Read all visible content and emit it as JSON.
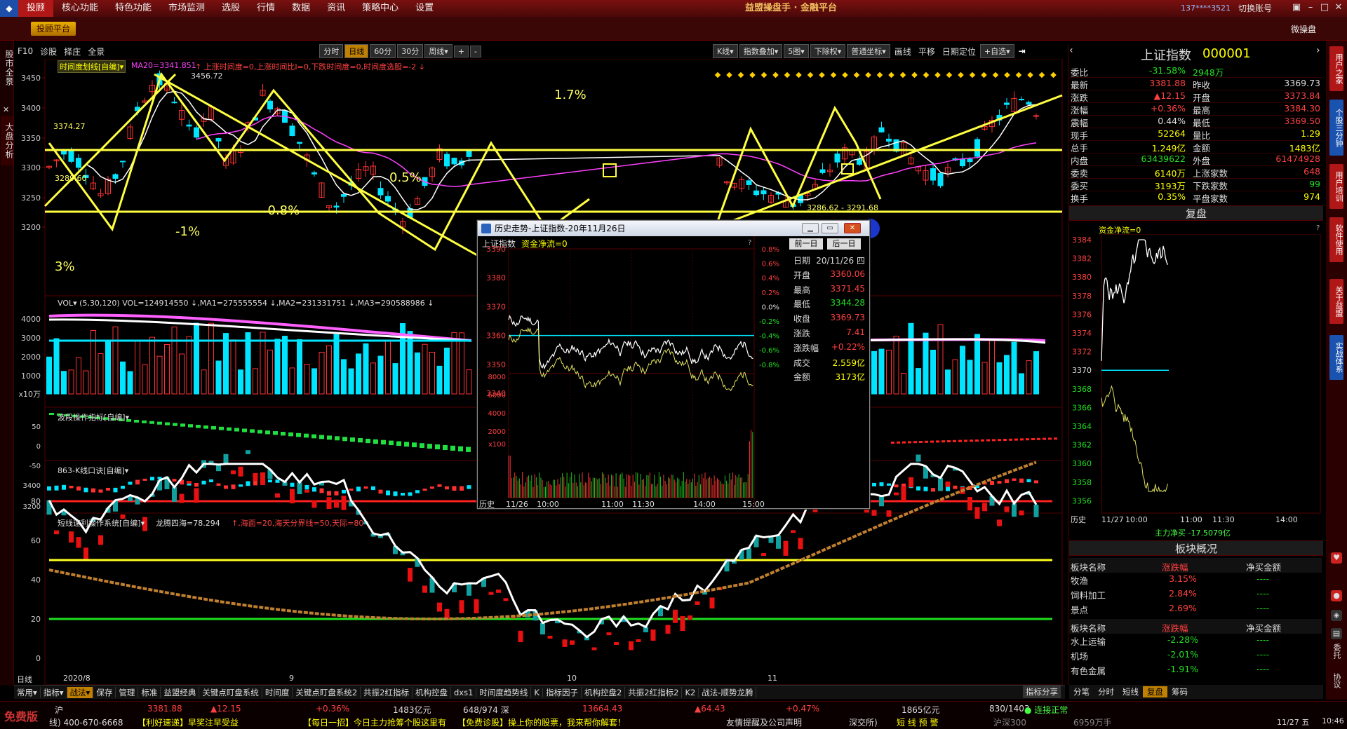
{
  "menu": {
    "items": [
      "投顾",
      "核心功能",
      "特色功能",
      "市场监测",
      "选股",
      "行情",
      "数据",
      "资讯",
      "策略中心",
      "设置"
    ],
    "title": "益盟操盘手 · 金融平台",
    "account": "137****3521",
    "switch_account": "切换账号"
  },
  "bar2": {
    "button": "投顾平台",
    "wei_pan": "微操盘"
  },
  "left_tabs": [
    "股市全景",
    "大盘分析"
  ],
  "right_tabs": [
    "用户之家",
    "个股三分钟",
    "用户培训",
    "软件使用",
    "关于益盟",
    "实战体系"
  ],
  "right_icons": [
    "推荐",
    "提醒",
    "鼠标",
    "锁定",
    "委托",
    "协议"
  ],
  "toolbar": {
    "left": [
      "F10",
      "诊股",
      "择庄",
      "全景"
    ],
    "periods": [
      "分时",
      "日线",
      "60分",
      "30分",
      "周线▾"
    ],
    "zoom": [
      "+",
      "-"
    ],
    "right": [
      "K线▾",
      "指数叠加▾",
      "5图▾",
      "下除权▾",
      "普通坐标▾",
      "画线",
      "平移",
      "日期定位",
      "+自选▾"
    ]
  },
  "main_chart": {
    "indicator_name": "时间度划线[自编]▾",
    "ma20": "MA20=3341.851",
    "info": "↑ 上涨时间度=0,上涨时间比I=0,下跌时间度=0,时间度选股=-2 ↓",
    "y_ticks": [
      "3450",
      "3400",
      "3350",
      "3300",
      "3250",
      "3200"
    ],
    "annotations": [
      "3456.72",
      "3289.60",
      "3374.27",
      "1.7%",
      "0.5%",
      "-0.8%",
      "-1%",
      "3%",
      "3286.62 - 3291.68"
    ]
  },
  "vol_chart": {
    "header": "VOL▾ (5,30,120) VOL=124914550 ↓,MA1=275555554 ↓,MA2=231331751 ↓,MA3=290588986 ↓",
    "y_ticks": [
      "4000",
      "3000",
      "2000",
      "1000",
      "x10万"
    ]
  },
  "wave_chart": {
    "header": "波段操作指标[自编]▾",
    "y_ticks": [
      "50",
      "0",
      "-50"
    ]
  },
  "k863_chart": {
    "header": "863-K线口诀[自编]▾",
    "y_ticks": [
      "3400",
      "3200"
    ]
  },
  "short_chart": {
    "header": "短线速利操作系统[自编]▾",
    "info_a": "龙腾四海=78.294",
    "info_b": "↑,海面=20,海天分界线=50,天际=80",
    "y_ticks": [
      "80",
      "60",
      "40",
      "20",
      "0"
    ]
  },
  "xaxis": {
    "period": "日线",
    "labels": [
      "2020/8",
      "9",
      "10",
      "11"
    ]
  },
  "bottom_tabs": [
    "常用▾",
    "指标▾",
    "战法▾",
    "保存",
    "管理",
    "标准",
    "益盟经典",
    "关键点盯盘系统",
    "时间度",
    "关键点盯盘系统2",
    "共振2红指标",
    "机构控盘",
    "dxs1",
    "时间度趋势线",
    "K",
    "指标因子",
    "机构控盘2",
    "共振2红指标2",
    "K2",
    "战法-顺势龙腾"
  ],
  "share_btn": "指标分享",
  "popup": {
    "title": "历史走势-上证指数-20年11月26日",
    "header_left": "上证指数",
    "header_money": "资金净流=0",
    "prev": "前一日",
    "next": "后一日",
    "y_left": [
      "3390",
      "3380",
      "3370",
      "3360",
      "3350",
      "3340"
    ],
    "y_right": [
      "0.8%",
      "0.6%",
      "0.4%",
      "0.2%",
      "0.0%",
      "-0.2%",
      "-0.4%",
      "-0.6%",
      "-0.8%"
    ],
    "vol_y": [
      "8000",
      "6000",
      "4000",
      "2000",
      "x100"
    ],
    "x_labels": [
      "历史",
      "11/26",
      "10:00",
      "11:00",
      "11:30",
      "14:00",
      "15:00"
    ],
    "info": [
      [
        "日期",
        "20/11/26 四"
      ],
      [
        "开盘",
        "3360.06"
      ],
      [
        "最高",
        "3371.45"
      ],
      [
        "最低",
        "3344.28"
      ],
      [
        "收盘",
        "3369.73"
      ],
      [
        "涨跌",
        "7.41"
      ],
      [
        "涨跌幅",
        "+0.22%"
      ],
      [
        "成交",
        "2.559亿"
      ],
      [
        "金额",
        "3173亿"
      ]
    ]
  },
  "right_panel": {
    "name": "上证指数",
    "code": "000001",
    "quote": [
      [
        "委比",
        "-31.58%",
        "2948万",
        ""
      ],
      [
        "最新",
        "3381.88",
        "昨收",
        "3369.73"
      ],
      [
        "涨跌",
        "▲12.15",
        "开盘",
        "3373.84"
      ],
      [
        "涨幅",
        "+0.36%",
        "最高",
        "3384.30"
      ],
      [
        "震幅",
        "0.44%",
        "最低",
        "3369.50"
      ],
      [
        "现手",
        "52264",
        "量比",
        "1.29"
      ],
      [
        "总手",
        "1.249亿",
        "金额",
        "1483亿"
      ],
      [
        "内盘",
        "63439622",
        "外盘",
        "61474928"
      ],
      [
        "委卖",
        "6140万",
        "上涨家数",
        "648"
      ],
      [
        "委买",
        "3193万",
        "下跌家数",
        "99"
      ],
      [
        "换手",
        "0.35%",
        "平盘家数",
        "974"
      ]
    ],
    "fupan": "复盘",
    "money_flow": "资金净流=0",
    "mini_y": [
      "3384",
      "3382",
      "3380",
      "3378",
      "3376",
      "3374",
      "3372",
      "3370",
      "3368",
      "3366",
      "3364",
      "3362",
      "3360",
      "3358",
      "3356"
    ],
    "mini_x": [
      "历史",
      "11/27",
      "10:00",
      "11:00",
      "11:30",
      "14:00"
    ],
    "main_net": "主力净买 -17.5079亿",
    "sector_title": "板块概况",
    "sector_header": [
      "板块名称",
      "涨跌幅",
      "净买金额"
    ],
    "sector_up": [
      [
        "牧渔",
        "3.15%",
        "----"
      ],
      [
        "饲料加工",
        "2.84%",
        "----"
      ],
      [
        "景点",
        "2.69%",
        "----"
      ]
    ],
    "sector_down": [
      [
        "水上运输",
        "-2.28%",
        "----"
      ],
      [
        "机场",
        "-2.01%",
        "----"
      ],
      [
        "有色金属",
        "-1.91%",
        "----"
      ]
    ],
    "bottom_tabs": [
      "分笔",
      "分时",
      "短线",
      "复盘",
      "筹码"
    ]
  },
  "ticker": {
    "brand": "免费版",
    "r1": [
      [
        "沪",
        "#ddd"
      ],
      [
        "3381.88",
        "#ff4040"
      ],
      [
        "▲12.15",
        "#ff4040"
      ],
      [
        "+0.36%",
        "#ff4040"
      ],
      [
        "1483亿元",
        "#ddd"
      ],
      [
        "648/974 深",
        "#ddd"
      ],
      [
        "13664.43",
        "#ff4040"
      ],
      [
        "▲64.43",
        "#ff4040"
      ],
      [
        "+0.47%",
        "#ff4040"
      ],
      [
        "1865亿元",
        "#ddd"
      ],
      [
        "830/1403",
        "#ddd"
      ],
      [
        "● 连接正常",
        "#4f4"
      ]
    ],
    "r2": [
      "线) 400-670-6668",
      "【利好速递】早奖注早受益",
      "【每日一招】今日主力抢筹个股这里有",
      "【免费诊股】操上你的股票，我来帮你解套！",
      "友情提醒及公司声明",
      "深交所)",
      "短 线 预 警",
      "沪深300",
      "6959万手"
    ],
    "date": "11/27 五",
    "time": "10:46"
  }
}
